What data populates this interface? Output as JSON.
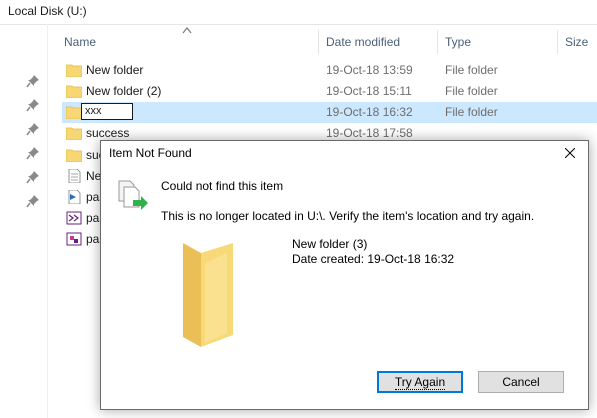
{
  "window": {
    "title": "Local Disk (U:)"
  },
  "columns": {
    "name": "Name",
    "date_modified": "Date modified",
    "type": "Type",
    "size": "Size"
  },
  "files": [
    {
      "name": "New folder",
      "date": "19-Oct-18 13:59",
      "type": "File folder",
      "icon": "folder-icon"
    },
    {
      "name": "New folder (2)",
      "date": "19-Oct-18 15:11",
      "type": "File folder",
      "icon": "folder-icon"
    },
    {
      "name": "xxx",
      "date": "19-Oct-18 16:32",
      "type": "File folder",
      "icon": "folder-icon",
      "renaming": true
    },
    {
      "name": "success",
      "date": "19-Oct-18 17:58",
      "type": "",
      "icon": "folder-icon"
    },
    {
      "name": "suc",
      "date": "",
      "type": "",
      "icon": "folder-icon"
    },
    {
      "name": "Ne",
      "date": "",
      "type": "",
      "icon": "text-file-icon"
    },
    {
      "name": "pas",
      "date": "",
      "type": "",
      "icon": "code-file-icon"
    },
    {
      "name": "pas",
      "date": "",
      "type": "",
      "icon": "project-file-icon"
    },
    {
      "name": "pas",
      "date": "",
      "type": "",
      "icon": "package-file-icon"
    }
  ],
  "dialog": {
    "title": "Item Not Found",
    "message": "Could not find this item",
    "detail": "This is no longer located in U:\\. Verify the item's location and try again.",
    "item_name": "New folder (3)",
    "item_date": "Date created: 19-Oct-18 16:32",
    "try_again_label": "Try Again",
    "cancel_label": "Cancel"
  },
  "colors": {
    "folder": "#f7d774",
    "selection": "#cce8ff",
    "accent": "#0078d7",
    "arrow": "#2fb34a"
  }
}
